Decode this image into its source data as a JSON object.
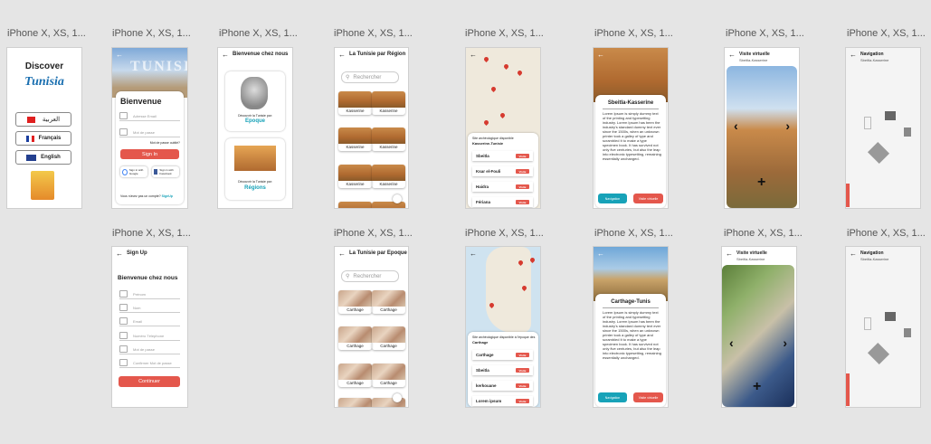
{
  "frame_label": "iPhone X, XS, 1...",
  "discover": {
    "title": "Discover",
    "brand": "Tunisia",
    "langs": [
      "العربية",
      "Français",
      "English"
    ]
  },
  "signin": {
    "title": "Bienvenue",
    "email_ph": "Adresse Email",
    "pass_ph": "Mot de passe",
    "forgot": "Mot de passe oublié?",
    "signin_btn": "Sign In",
    "google": "Sign in with Google",
    "facebook": "Sign in with Facebook",
    "no_account": "Vous n'avez pas un compte?",
    "signup_link": "SignUp",
    "hero_text": "TUNISIA"
  },
  "bienvenue": {
    "title": "Bienvenue chez nous",
    "epoch_caption": "Découvrir la Tunisie par:",
    "epoch_label": "Epoque",
    "region_caption": "Découvrir la Tunisie par:",
    "region_label": "Régions"
  },
  "region": {
    "title": "La Tunisie par Région",
    "search": "Rechercher",
    "tile_label": "Kasserine"
  },
  "epoque": {
    "title": "La Tunisie par Epoque",
    "search": "Rechercher",
    "tile_label": "Carthage"
  },
  "map1": {
    "header": "Site archéologique disponible",
    "region": "Kasserine-Tunisie",
    "items": [
      "Sbeitla",
      "Ksar el-Fouli",
      "Haidra",
      "Fériana"
    ],
    "btn": "Visite"
  },
  "map2": {
    "header": "Site archéologique disponible à l'époque des",
    "region": "Carthage",
    "items": [
      "Carthage",
      "Sbeitla",
      "kerkouane",
      "Lorem ipsum"
    ],
    "btn": "Visite"
  },
  "detail1": {
    "title": "Sbeitla-Kasserine",
    "body": "Lorem Ipsum is simply dummy text of the printing and typesetting industry. Lorem Ipsum has been the industry's standard dummy text ever since the 1500s, when an unknown printer took a galley of type and scrambled it to make a type specimen book. It has survived not only five centuries, but also the leap into electronic typesetting, remaining essentially unchanged.",
    "nav_btn": "Navigation",
    "vr_btn": "Visite virtuelle"
  },
  "detail2": {
    "title": "Carthage-Tunis",
    "body": "Lorem Ipsum is simply dummy text of the printing and typesetting industry. Lorem Ipsum has been the industry's standard dummy text ever since the 1500s, when an unknown printer took a galley of type and scrambled it to make a type specimen book. It has survived not only five centuries, but also the leap into electronic typesetting, remaining essentially unchanged.",
    "nav_btn": "Navigation",
    "vr_btn": "Visite virtuelle"
  },
  "vr1": {
    "title": "Visite virtuelle",
    "sub": "Sbeitla-Kasserine"
  },
  "vr2": {
    "title": "Visite virtuelle",
    "sub": "Sbeitla-Kasserine"
  },
  "nav1": {
    "title": "Navigation",
    "sub": "Sbeitla-Kasserine"
  },
  "nav2": {
    "title": "Navigation",
    "sub": "Sbeitla-Kasserine"
  },
  "signup": {
    "title": "Sign Up",
    "heading": "Bienvenue chez nous",
    "fields": [
      "Prénom",
      "Nom",
      "Email",
      "Numéro Télephone",
      "Mot de passe",
      "Confirmer Mot de passe"
    ],
    "btn": "Continuer"
  },
  "colors": {
    "accent_red": "#e4574c",
    "teal": "#17a2b8",
    "bg": "#e5e5e5"
  }
}
